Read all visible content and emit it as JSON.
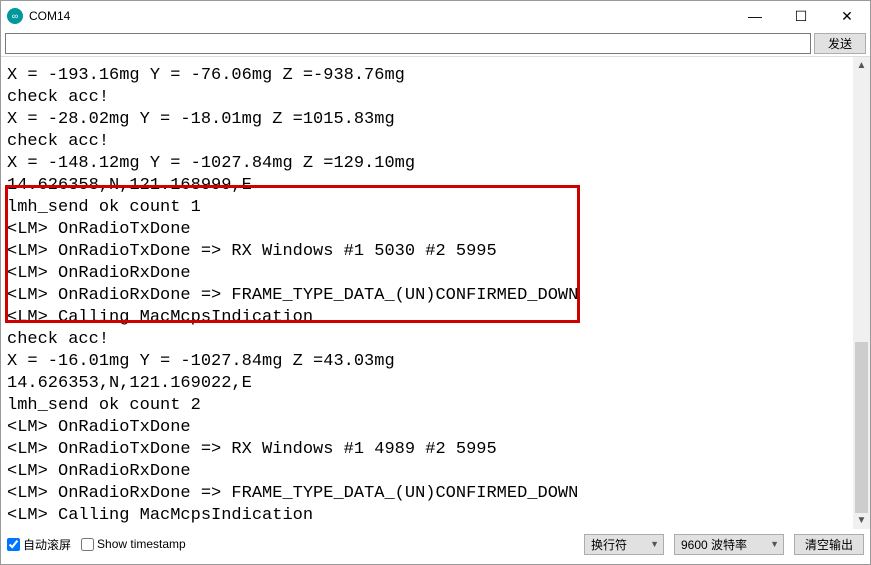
{
  "window": {
    "title": "COM14",
    "app_icon_glyph": "∞",
    "minimize_glyph": "—",
    "maximize_glyph": "☐",
    "close_glyph": "✕"
  },
  "toolbar": {
    "input_value": "",
    "input_placeholder": "",
    "send_label": "发送"
  },
  "output_lines": [
    "X = -193.16mg Y = -76.06mg Z =-938.76mg",
    "check acc!",
    "X = -28.02mg Y = -18.01mg Z =1015.83mg",
    "check acc!",
    "X = -148.12mg Y = -1027.84mg Z =129.10mg",
    "14.626358,N,121.168999,E",
    "lmh_send ok count 1",
    "<LM> OnRadioTxDone",
    "<LM> OnRadioTxDone => RX Windows #1 5030 #2 5995",
    "<LM> OnRadioRxDone",
    "<LM> OnRadioRxDone => FRAME_TYPE_DATA_(UN)CONFIRMED_DOWN",
    "<LM> Calling MacMcpsIndication",
    "check acc!",
    "X = -16.01mg Y = -1027.84mg Z =43.03mg",
    "14.626353,N,121.169022,E",
    "lmh_send ok count 2",
    "<LM> OnRadioTxDone",
    "<LM> OnRadioTxDone => RX Windows #1 4989 #2 5995",
    "<LM> OnRadioRxDone",
    "<LM> OnRadioRxDone => FRAME_TYPE_DATA_(UN)CONFIRMED_DOWN",
    "<LM> Calling MacMcpsIndication"
  ],
  "footer": {
    "autoscroll_label": "自动滚屏",
    "autoscroll_checked": true,
    "timestamp_label": "Show timestamp",
    "timestamp_checked": false,
    "line_ending_value": "换行符",
    "baud_value": "9600 波特率",
    "clear_label": "清空输出"
  }
}
